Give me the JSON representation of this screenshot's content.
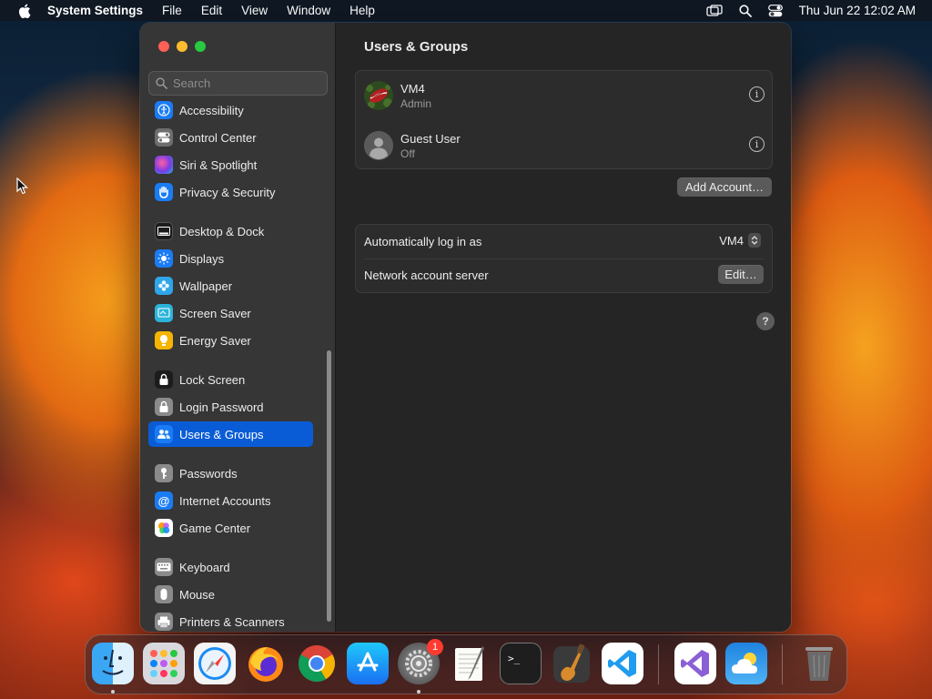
{
  "menubar": {
    "app_name": "System Settings",
    "menus": [
      "File",
      "Edit",
      "View",
      "Window",
      "Help"
    ],
    "clock": "Thu Jun 22  12:02 AM"
  },
  "sidebar": {
    "search_placeholder": "Search",
    "items": [
      {
        "label": "Accessibility",
        "icon": "accessibility-icon",
        "color": "#1a7cf5"
      },
      {
        "label": "Control Center",
        "icon": "control-center-icon",
        "color": "#6e6e6e"
      },
      {
        "label": "Siri & Spotlight",
        "icon": "siri-icon",
        "color": "#b23ad8"
      },
      {
        "label": "Privacy & Security",
        "icon": "hand-icon",
        "color": "#1a7cf5"
      },
      {
        "label": "Desktop & Dock",
        "icon": "dock-icon",
        "color": "#1c1c1c"
      },
      {
        "label": "Displays",
        "icon": "sun-icon",
        "color": "#1a7cf5"
      },
      {
        "label": "Wallpaper",
        "icon": "flower-icon",
        "color": "#2ea6e8"
      },
      {
        "label": "Screen Saver",
        "icon": "screen-saver-icon",
        "color": "#2bb4d9"
      },
      {
        "label": "Energy Saver",
        "icon": "battery-icon",
        "color": "#f4b400"
      },
      {
        "label": "Lock Screen",
        "icon": "lock-icon",
        "color": "#1c1c1c"
      },
      {
        "label": "Login Password",
        "icon": "padlock-icon",
        "color": "#8a8a8a"
      },
      {
        "label": "Users & Groups",
        "icon": "users-icon",
        "color": "#1a7cf5"
      },
      {
        "label": "Passwords",
        "icon": "key-icon",
        "color": "#8a8a8a"
      },
      {
        "label": "Internet Accounts",
        "icon": "at-icon",
        "color": "#1a7cf5"
      },
      {
        "label": "Game Center",
        "icon": "game-center-icon",
        "color": "#ffffff"
      },
      {
        "label": "Keyboard",
        "icon": "keyboard-icon",
        "color": "#8a8a8a"
      },
      {
        "label": "Mouse",
        "icon": "mouse-icon",
        "color": "#8a8a8a"
      },
      {
        "label": "Printers & Scanners",
        "icon": "printer-icon",
        "color": "#8a8a8a"
      }
    ],
    "active_label": "Users & Groups"
  },
  "main": {
    "title": "Users & Groups",
    "users": [
      {
        "name": "VM4",
        "role": "Admin"
      },
      {
        "name": "Guest User",
        "role": "Off"
      }
    ],
    "add_account_label": "Add Account…",
    "auto_login_label": "Automatically log in as",
    "auto_login_value": "VM4",
    "network_server_label": "Network account server",
    "edit_label": "Edit…",
    "help_label": "?"
  },
  "dock": {
    "apps": [
      "Finder",
      "Launchpad",
      "Safari",
      "Firefox",
      "Chrome",
      "App Store",
      "System Settings",
      "TextEdit",
      "Terminal",
      "GarageBand",
      "Visual Studio Code",
      "Visual Studio",
      "Weather",
      "Trash"
    ],
    "settings_badge": "1"
  }
}
